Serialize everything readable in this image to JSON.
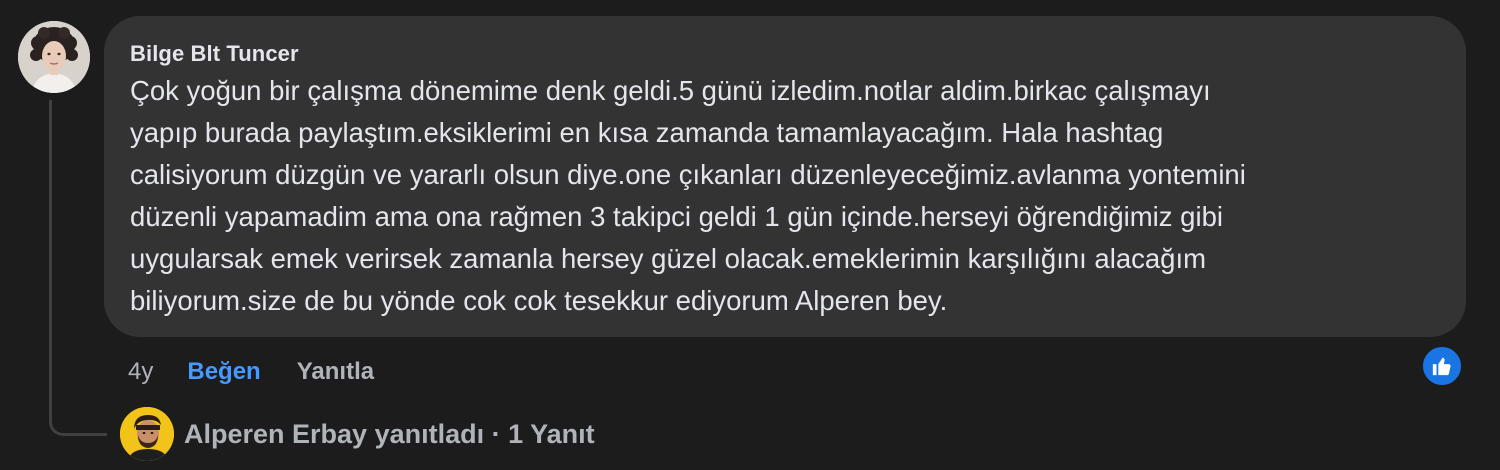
{
  "comment": {
    "author": "Bilge Blt Tuncer",
    "lines": [
      "Çok yoğun bir çalışma dönemime denk geldi.5 günü izledim.notlar aldim.birkac çalışmayı",
      "yapıp burada paylaştım.eksiklerimi en kısa zamanda tamamlayacağım. Hala hashtag",
      "calisiyorum düzgün ve yararlı olsun diye.one çıkanları düzenleyeceğimiz.avlanma yontemini",
      "düzenli yapamadim ama ona rağmen 3 takipci geldi 1 gün içinde.herseyi öğrendiğimiz gibi",
      "uygularsak emek verirsek zamanla hersey güzel olacak.emeklerimin karşılığını alacağım",
      "biliyorum.size de bu yönde cok cok tesekkur ediyorum Alperen bey."
    ],
    "avatar_icon": "user-avatar-photo",
    "reaction_icon": "thumbs-up-icon",
    "reaction_color": "#1b74e4"
  },
  "actions": {
    "time": "4y",
    "like_label": "Beğen",
    "reply_label": "Yanıtla",
    "like_color": "#4599ff"
  },
  "reply_summary": {
    "text": "Alperen Erbay yanıtladı · 1 Yanıt",
    "avatar_icon": "user-avatar-photo"
  },
  "colors": {
    "background": "#1c1c1d",
    "bubble": "#333334",
    "text_primary": "#e4e6eb",
    "text_secondary": "#b0b3b8"
  }
}
